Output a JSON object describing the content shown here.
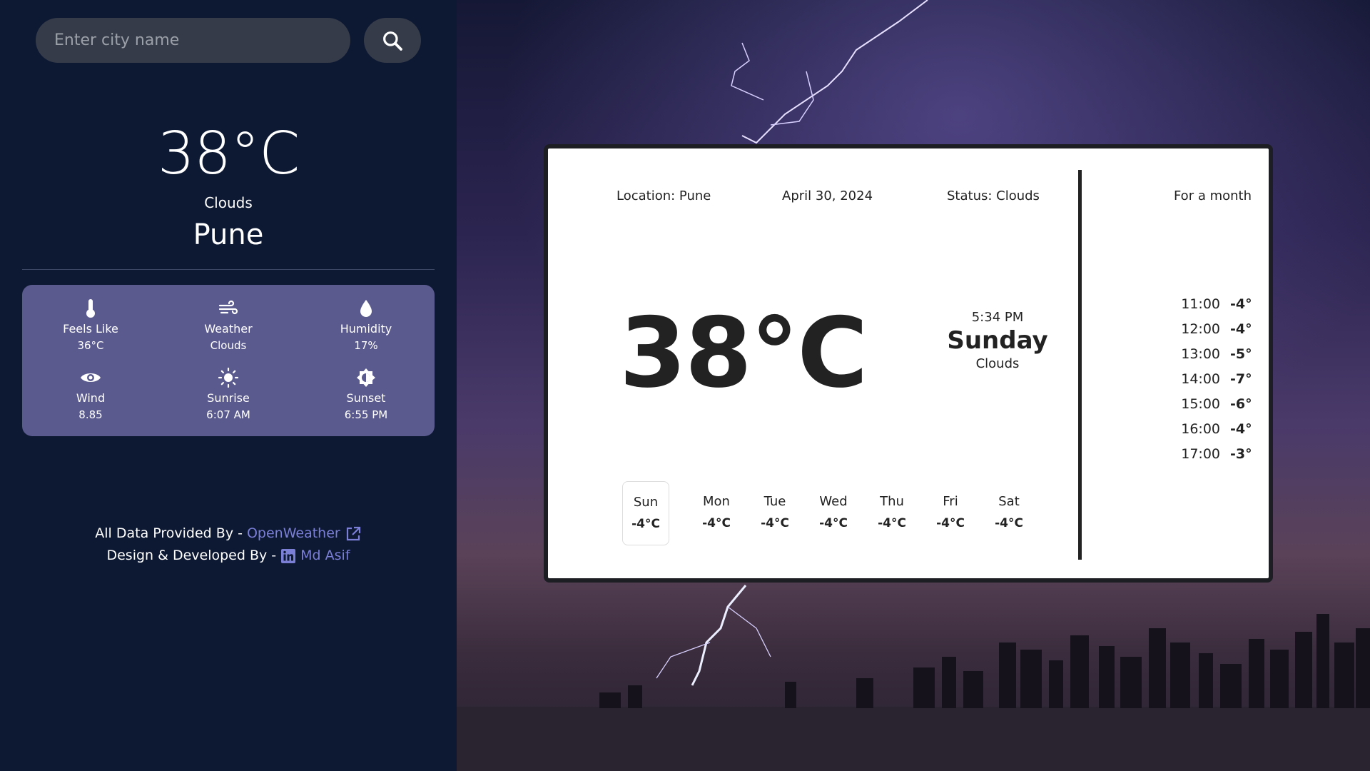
{
  "search": {
    "placeholder": "Enter city name"
  },
  "current": {
    "temp": "38°C",
    "status": "Clouds",
    "city": "Pune"
  },
  "stats": [
    {
      "icon": "thermometer-icon",
      "label": "Feels Like",
      "value": "36°C"
    },
    {
      "icon": "wind-icon",
      "label": "Weather",
      "value": "Clouds"
    },
    {
      "icon": "droplet-icon",
      "label": "Humidity",
      "value": "17%"
    },
    {
      "icon": "eye-icon",
      "label": "Wind",
      "value": "8.85"
    },
    {
      "icon": "sun-icon",
      "label": "Sunrise",
      "value": "6:07 AM"
    },
    {
      "icon": "brightness-icon",
      "label": "Sunset",
      "value": "6:55 PM"
    }
  ],
  "credits": {
    "data_prefix": "All Data Provided By -",
    "data_link": "OpenWeather",
    "dev_prefix": "Design & Developed By -",
    "dev_link": "Md Asif"
  },
  "card": {
    "location": "Location: Pune",
    "date": "April 30, 2024",
    "status": "Status: Clouds",
    "temp": "38°C",
    "time": "5:34 PM",
    "day": "Sunday",
    "condition": "Clouds",
    "month_label": "For a month"
  },
  "week": [
    {
      "day": "Sun",
      "temp": "-4°C",
      "active": true
    },
    {
      "day": "Mon",
      "temp": "-4°C"
    },
    {
      "day": "Tue",
      "temp": "-4°C"
    },
    {
      "day": "Wed",
      "temp": "-4°C"
    },
    {
      "day": "Thu",
      "temp": "-4°C"
    },
    {
      "day": "Fri",
      "temp": "-4°C"
    },
    {
      "day": "Sat",
      "temp": "-4°C"
    }
  ],
  "hourly": [
    {
      "time": "11:00",
      "temp": "-4°"
    },
    {
      "time": "12:00",
      "temp": "-4°"
    },
    {
      "time": "13:00",
      "temp": "-5°"
    },
    {
      "time": "14:00",
      "temp": "-7°"
    },
    {
      "time": "15:00",
      "temp": "-6°"
    },
    {
      "time": "16:00",
      "temp": "-4°"
    },
    {
      "time": "17:00",
      "temp": "-3°"
    }
  ],
  "colors": {
    "sidebar": "#0d1833",
    "card_stats": "#5a5a8e",
    "link": "#7b7fd6"
  }
}
